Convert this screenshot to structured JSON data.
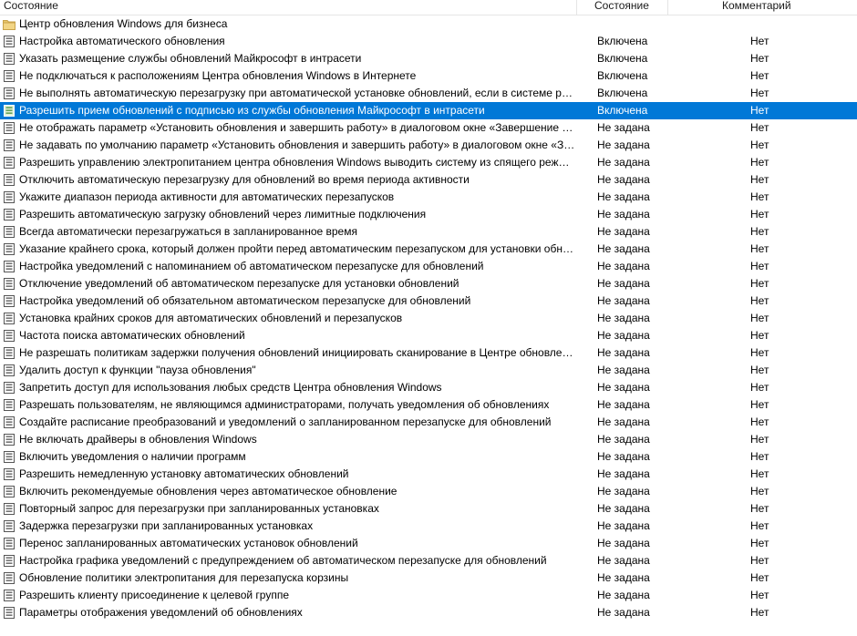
{
  "columns": {
    "name": "Состояние",
    "state": "Состояние",
    "comment": "Комментарий"
  },
  "colors": {
    "selection": "#0078d7",
    "folder": "#e8c56b"
  },
  "folder": {
    "label": "Центр обновления Windows для бизнеса",
    "icon": "folder-icon"
  },
  "rows": [
    {
      "name": "Настройка автоматического обновления",
      "state": "Включена",
      "comment": "Нет"
    },
    {
      "name": "Указать размещение службы обновлений Майкрософт в интрасети",
      "state": "Включена",
      "comment": "Нет"
    },
    {
      "name": "Не подключаться к расположениям Центра обновления Windows в Интернете",
      "state": "Включена",
      "comment": "Нет"
    },
    {
      "name": "Не выполнять автоматическую перезагрузку при автоматической установке обновлений, если в системе работают пользователи",
      "state": "Включена",
      "comment": "Нет"
    },
    {
      "name": "Разрешить прием обновлений с подписью из службы обновления Майкрософт в интрасети",
      "state": "Включена",
      "comment": "Нет",
      "selected": true
    },
    {
      "name": "Не отображать параметр «Установить обновления и завершить работу» в диалоговом окне «Завершение работы Windows»",
      "state": "Не задана",
      "comment": "Нет"
    },
    {
      "name": "Не задавать по умолчанию параметр «Установить обновления и завершить работу» в диалоговом окне «Завершение работы Windows»",
      "state": "Не задана",
      "comment": "Нет"
    },
    {
      "name": "Разрешить управлению электропитанием центра обновления Windows выводить систему из спящего режима",
      "state": "Не задана",
      "comment": "Нет"
    },
    {
      "name": "Отключить автоматическую перезагрузку для обновлений во время периода активности",
      "state": "Не задана",
      "comment": "Нет"
    },
    {
      "name": "Укажите диапазон периода активности для автоматических перезапусков",
      "state": "Не задана",
      "comment": "Нет"
    },
    {
      "name": "Разрешить автоматическую загрузку обновлений через лимитные подключения",
      "state": "Не задана",
      "comment": "Нет"
    },
    {
      "name": "Всегда автоматически перезагружаться в запланированное время",
      "state": "Не задана",
      "comment": "Нет"
    },
    {
      "name": "Указание крайнего срока, который должен пройти перед автоматическим перезапуском для установки обновлений",
      "state": "Не задана",
      "comment": "Нет"
    },
    {
      "name": "Настройка уведомлений с напоминанием об автоматическом перезапуске для обновлений",
      "state": "Не задана",
      "comment": "Нет"
    },
    {
      "name": "Отключение уведомлений об автоматическом перезапуске для установки обновлений",
      "state": "Не задана",
      "comment": "Нет"
    },
    {
      "name": "Настройка уведомлений об обязательном автоматическом перезапуске для обновлений",
      "state": "Не задана",
      "comment": "Нет"
    },
    {
      "name": "Установка крайних сроков для автоматических обновлений и перезапусков",
      "state": "Не задана",
      "comment": "Нет"
    },
    {
      "name": "Частота поиска автоматических обновлений",
      "state": "Не задана",
      "comment": "Нет"
    },
    {
      "name": "Не разрешать политикам задержки получения обновлений инициировать сканирование в Центре обновления Windows",
      "state": "Не задана",
      "comment": "Нет"
    },
    {
      "name": "Удалить доступ к функции \"пауза обновления\"",
      "state": "Не задана",
      "comment": "Нет"
    },
    {
      "name": "Запретить доступ для использования любых средств Центра обновления Windows",
      "state": "Не задана",
      "comment": "Нет"
    },
    {
      "name": "Разрешать пользователям, не являющимся администраторами, получать уведомления об обновлениях",
      "state": "Не задана",
      "comment": "Нет"
    },
    {
      "name": "Создайте расписание преобразований и уведомлений о запланированном перезапуске для обновлений",
      "state": "Не задана",
      "comment": "Нет"
    },
    {
      "name": "Не включать драйверы в обновления Windows",
      "state": "Не задана",
      "comment": "Нет"
    },
    {
      "name": "Включить уведомления о наличии программ",
      "state": "Не задана",
      "comment": "Нет"
    },
    {
      "name": "Разрешить немедленную установку автоматических обновлений",
      "state": "Не задана",
      "comment": "Нет"
    },
    {
      "name": "Включить рекомендуемые обновления через автоматическое обновление",
      "state": "Не задана",
      "comment": "Нет"
    },
    {
      "name": "Повторный запрос для перезагрузки при запланированных установках",
      "state": "Не задана",
      "comment": "Нет"
    },
    {
      "name": "Задержка перезагрузки при запланированных установках",
      "state": "Не задана",
      "comment": "Нет"
    },
    {
      "name": "Перенос запланированных автоматических установок обновлений",
      "state": "Не задана",
      "comment": "Нет"
    },
    {
      "name": "Настройка графика уведомлений с предупреждением об автоматическом перезапуске для обновлений",
      "state": "Не задана",
      "comment": "Нет"
    },
    {
      "name": "Обновление политики электропитания для перезапуска корзины",
      "state": "Не задана",
      "comment": "Нет"
    },
    {
      "name": "Разрешить клиенту присоединение к целевой группе",
      "state": "Не задана",
      "comment": "Нет"
    },
    {
      "name": "Параметры отображения уведомлений об обновлениях",
      "state": "Не задана",
      "comment": "Нет"
    }
  ]
}
